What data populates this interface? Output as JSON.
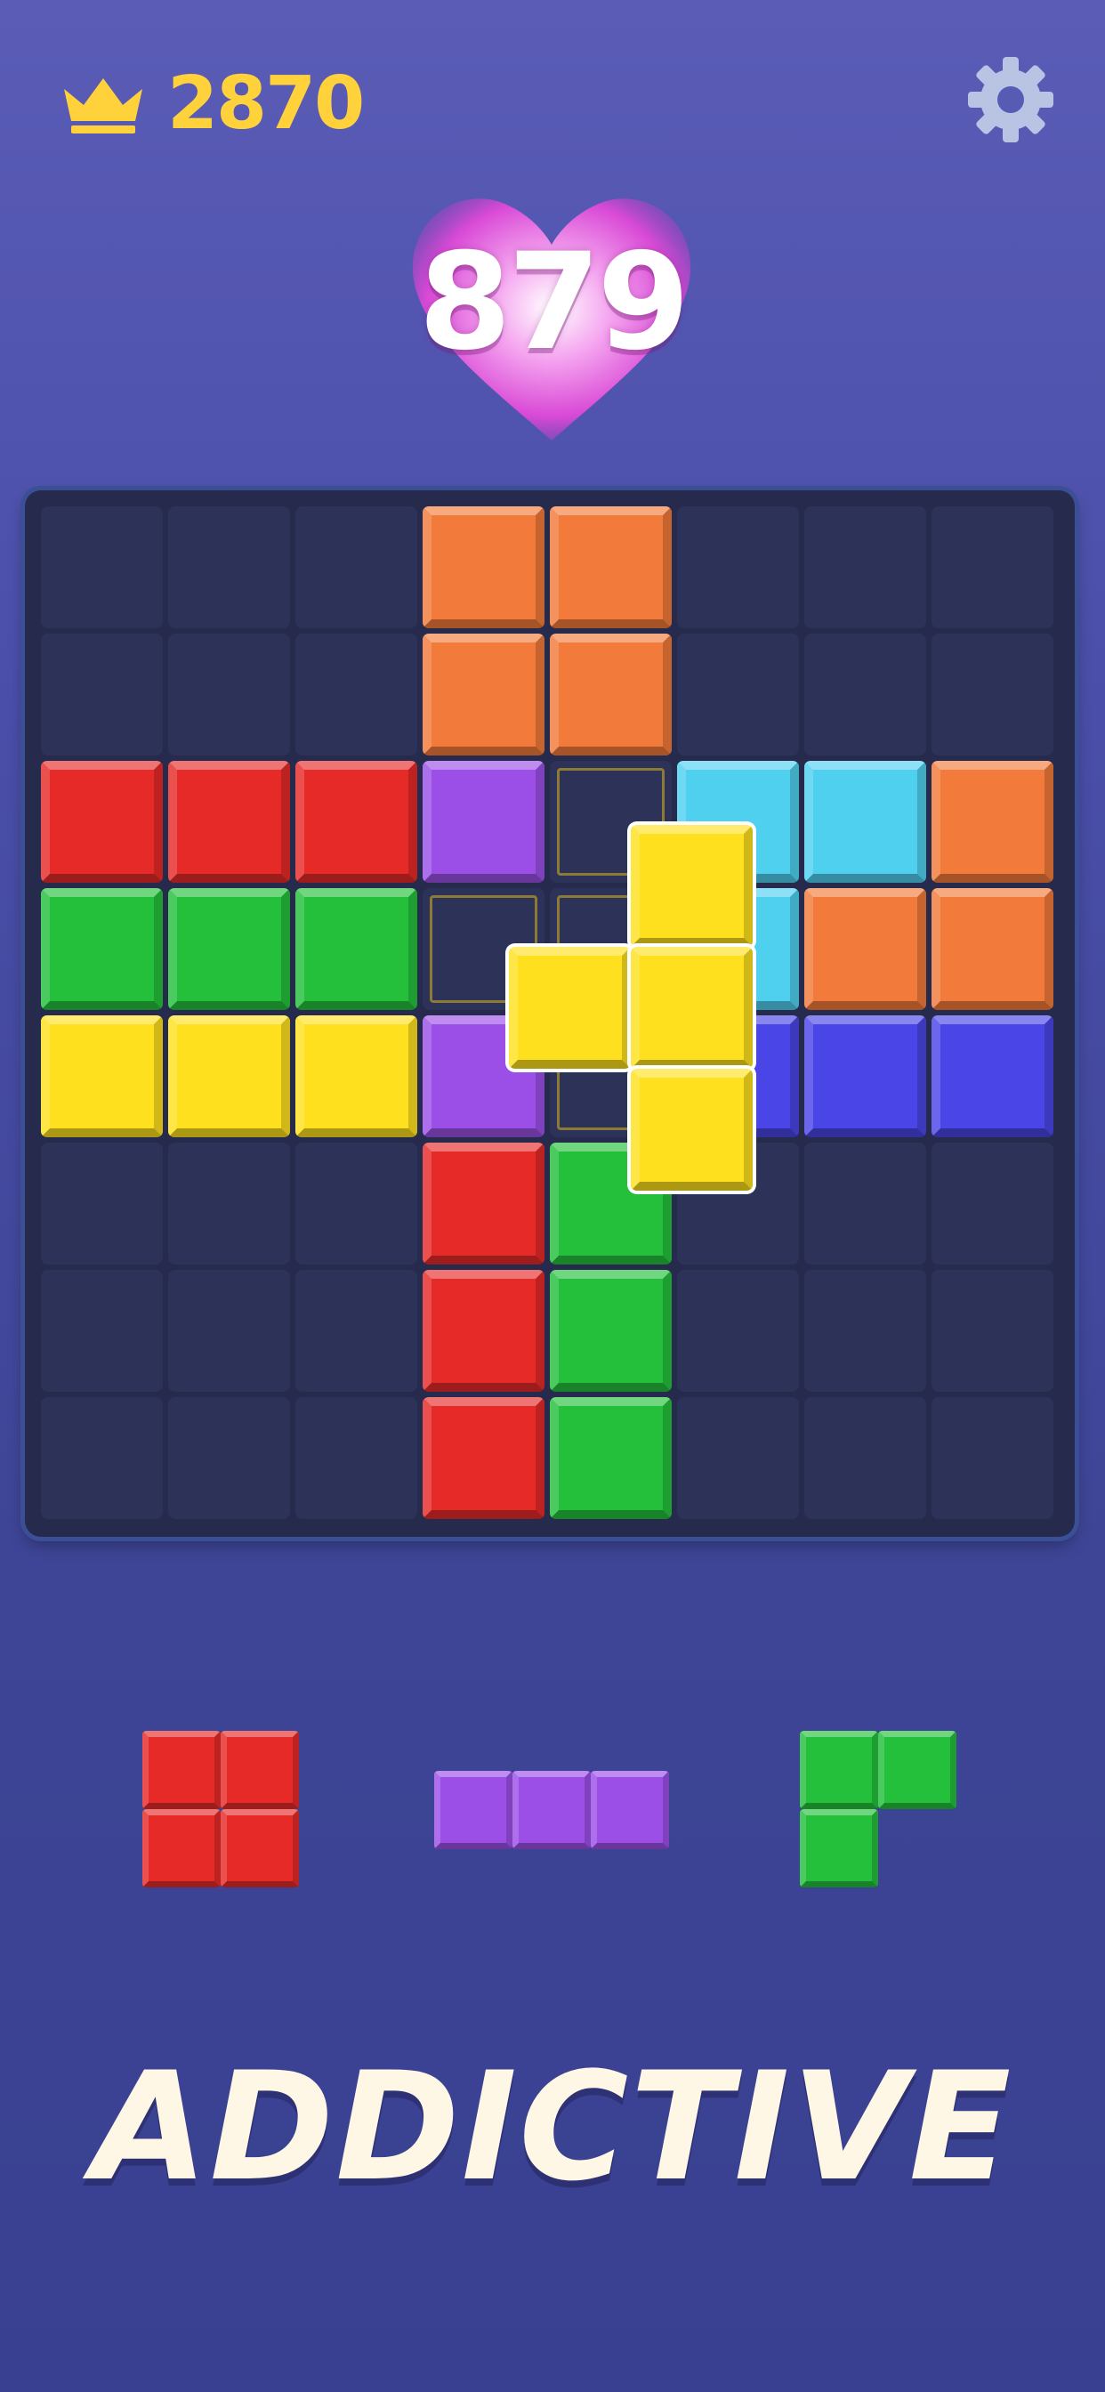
{
  "header": {
    "best_score": "2870",
    "crown_icon": "crown-icon",
    "settings_icon": "gear-icon"
  },
  "score": {
    "value": "879",
    "badge_icon": "heart-icon"
  },
  "board": {
    "rows": 8,
    "cols": 8,
    "grid": [
      [
        "empty",
        "empty",
        "empty",
        "orange",
        "orange",
        "empty",
        "empty",
        "empty"
      ],
      [
        "empty",
        "empty",
        "empty",
        "orange",
        "orange",
        "empty",
        "empty",
        "empty"
      ],
      [
        "red",
        "red",
        "red",
        "purple",
        "empty",
        "cyan",
        "cyan",
        "orange"
      ],
      [
        "green",
        "green",
        "green",
        "empty",
        "empty",
        "cyan",
        "orange",
        "orange"
      ],
      [
        "yellow",
        "yellow",
        "yellow",
        "purple",
        "empty",
        "blue",
        "blue",
        "blue"
      ],
      [
        "empty",
        "empty",
        "empty",
        "red",
        "green",
        "empty",
        "empty",
        "empty"
      ],
      [
        "empty",
        "empty",
        "empty",
        "red",
        "green",
        "empty",
        "empty",
        "empty"
      ],
      [
        "empty",
        "empty",
        "empty",
        "red",
        "green",
        "empty",
        "empty",
        "empty"
      ]
    ],
    "placement_hint_cells": [
      [
        2,
        4
      ],
      [
        3,
        3
      ],
      [
        3,
        4
      ],
      [
        4,
        4
      ]
    ],
    "dragging_piece": {
      "color": "yellow",
      "shape": "T-left"
    }
  },
  "tray": {
    "pieces": [
      {
        "name": "red-square-piece",
        "color": "red",
        "shape": "2x2 square"
      },
      {
        "name": "purple-line-piece",
        "color": "purple",
        "shape": "1x3 line"
      },
      {
        "name": "green-corner-piece",
        "color": "green",
        "shape": "L corner"
      }
    ]
  },
  "colors": {
    "red": "#e52a27",
    "orange": "#f27a3a",
    "purple": "#9b4fe6",
    "cyan": "#4fd0ef",
    "green": "#24c03c",
    "yellow": "#ffe01e",
    "blue": "#4a45e6",
    "empty": "#2d3358",
    "gold": "#ffd23c",
    "heart": "#e64fd8"
  },
  "slogan": "ADDICTIVE"
}
